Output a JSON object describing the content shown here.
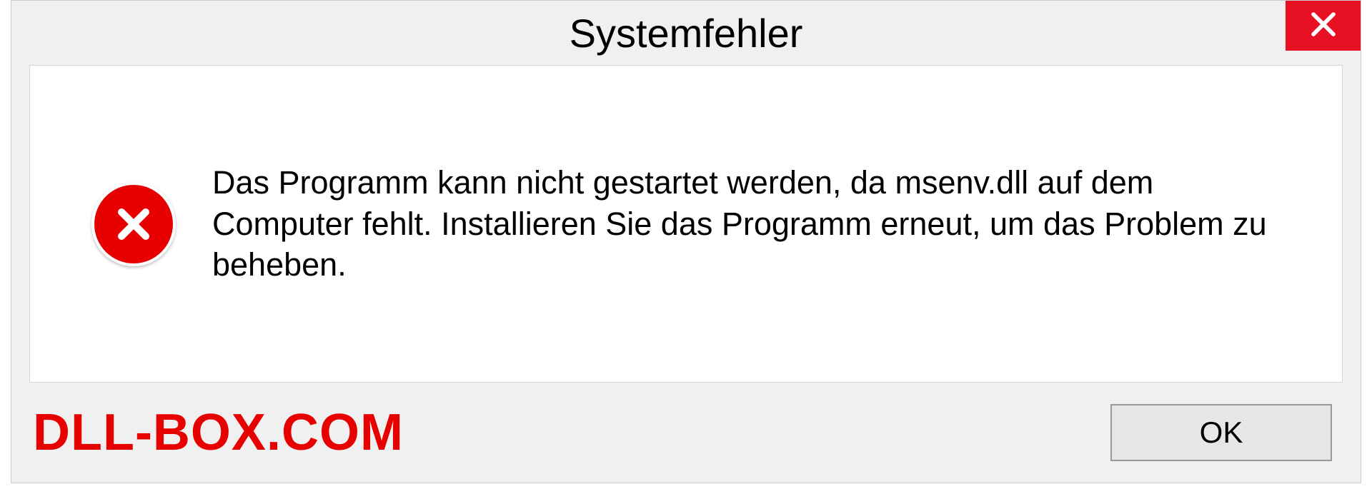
{
  "dialog": {
    "title": "Systemfehler",
    "message": "Das Programm kann nicht gestartet werden, da msenv.dll auf dem Computer fehlt. Installieren Sie das Programm erneut, um das Problem zu beheben.",
    "ok_label": "OK"
  },
  "watermark": "DLL-BOX.COM"
}
